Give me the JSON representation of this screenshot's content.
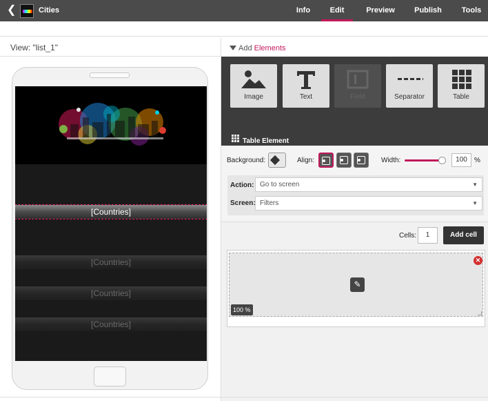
{
  "app": {
    "title": "Cities",
    "back_icon": "chevron-left-icon"
  },
  "nav": [
    {
      "label": "Info",
      "active": false
    },
    {
      "label": "Edit",
      "active": true
    },
    {
      "label": "Preview",
      "active": false
    },
    {
      "label": "Publish",
      "active": false
    },
    {
      "label": "Tools",
      "active": false
    }
  ],
  "view": {
    "label": "View: \"list_1\""
  },
  "phone": {
    "rows": [
      {
        "text": "[Countries]",
        "selected": true
      },
      {
        "text": "[Countries]",
        "selected": false
      },
      {
        "text": "[Countries]",
        "selected": false
      },
      {
        "text": "[Countries]",
        "selected": false
      }
    ]
  },
  "add_elements": {
    "prefix": "Add",
    "highlight": "Elements"
  },
  "palette": [
    {
      "label": "Image",
      "icon": "image-icon",
      "disabled": false
    },
    {
      "label": "Text",
      "icon": "text-icon",
      "disabled": false
    },
    {
      "label": "Field",
      "icon": "field-icon",
      "disabled": true
    },
    {
      "label": "Separator",
      "icon": "separator-icon",
      "disabled": false
    },
    {
      "label": "Table",
      "icon": "table-icon",
      "disabled": false
    }
  ],
  "element_title": "Table Element",
  "properties": {
    "background_label": "Background:",
    "align_label": "Align:",
    "width_label": "Width:",
    "width_value": "100",
    "width_unit": "%",
    "action_label": "Action:",
    "action_value": "Go to screen",
    "screen_label": "Screen:",
    "screen_value": "Filters"
  },
  "cells": {
    "label": "Cells:",
    "value": "1",
    "add_label": "Add cell",
    "cell_width": "100 %"
  },
  "colors": {
    "accent": "#c2185b",
    "topbar": "#4b4b4b",
    "palette_bg": "#3c3c3c"
  }
}
